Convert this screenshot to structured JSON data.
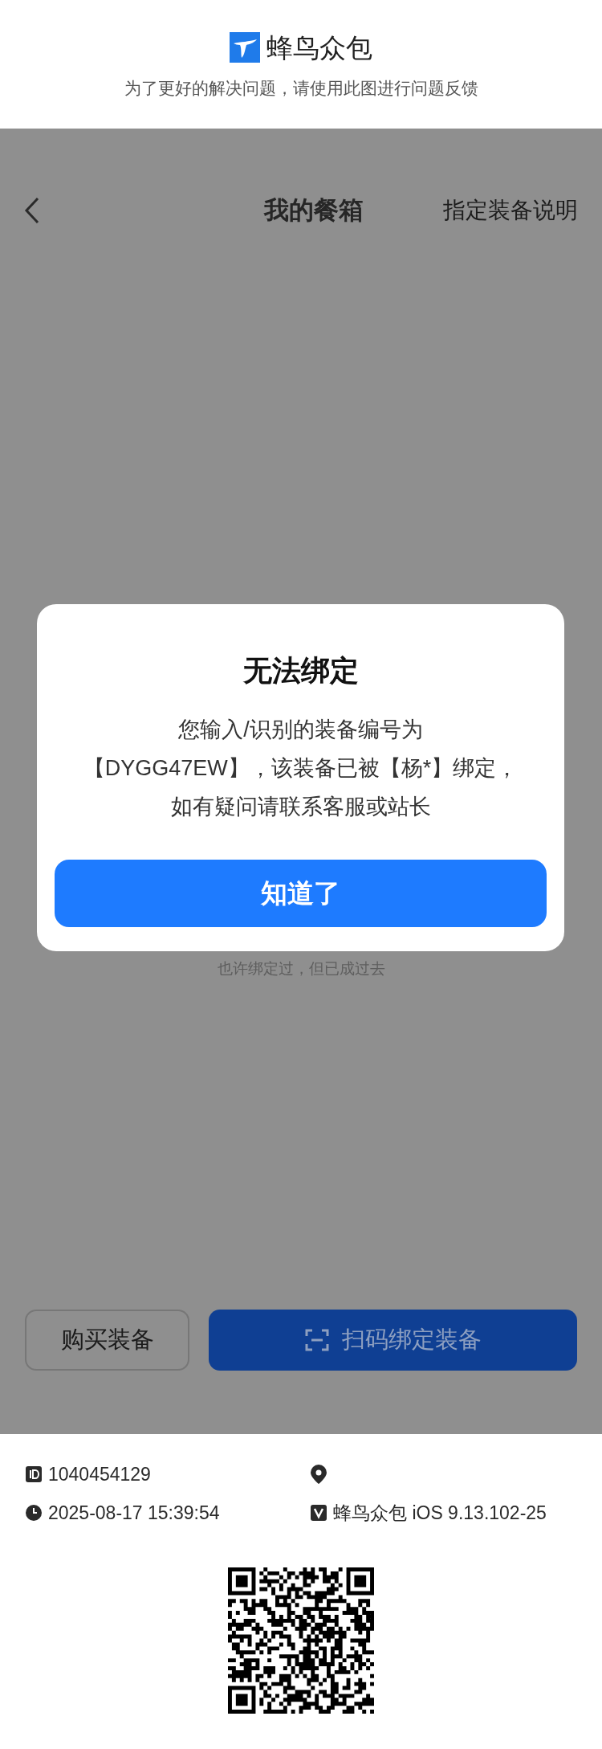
{
  "header": {
    "app_name": "蜂鸟众包",
    "subtitle": "为了更好的解决问题，请使用此图进行问题反馈"
  },
  "nav": {
    "title": "我的餐箱",
    "action": "指定装备说明"
  },
  "background_hint": "也许绑定过，但已成过去",
  "dialog": {
    "title": "无法绑定",
    "message_lines": [
      "您输入/识别的装备编号为",
      "【DYGG47EW】，该装备已被【杨*】绑定，",
      "如有疑问请联系客服或站长"
    ],
    "button": "知道了"
  },
  "buttons": [
    {
      "label": "购买装备",
      "kind": "outline"
    },
    {
      "label": "扫码绑定装备",
      "kind": "primary"
    }
  ],
  "footer": {
    "user_id": "1040454129",
    "time": "2025-08-17 15:39:54",
    "app_version": "蜂鸟众包 iOS 9.13.102-25"
  }
}
